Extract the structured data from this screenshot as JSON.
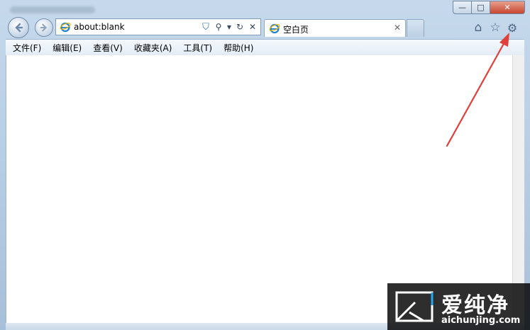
{
  "window": {
    "caption_buttons": {
      "minimize": "—",
      "maximize": "□",
      "close": "✕"
    }
  },
  "nav": {
    "back_icon": "back-arrow-icon",
    "forward_icon": "forward-arrow-icon"
  },
  "address_bar": {
    "value": "about:blank",
    "tools": {
      "compat": "⛉",
      "search": "⚲",
      "dropdown": "▾",
      "refresh": "↻",
      "stop": "✕"
    }
  },
  "tab": {
    "label": "空白页",
    "close": "✕"
  },
  "toolbar_icons": {
    "home": "⌂",
    "favorites": "☆",
    "tools": "⚙"
  },
  "menu": [
    {
      "label": "文件(F)"
    },
    {
      "label": "编辑(E)"
    },
    {
      "label": "查看(V)"
    },
    {
      "label": "收藏夹(A)"
    },
    {
      "label": "工具(T)"
    },
    {
      "label": "帮助(H)"
    }
  ],
  "watermark": {
    "brand": "爱纯净",
    "url": "aichunjing.com"
  },
  "colors": {
    "annotation_arrow": "#e0403a",
    "ie_blue": "#1f7fd3",
    "ie_gold": "#e8b400"
  }
}
